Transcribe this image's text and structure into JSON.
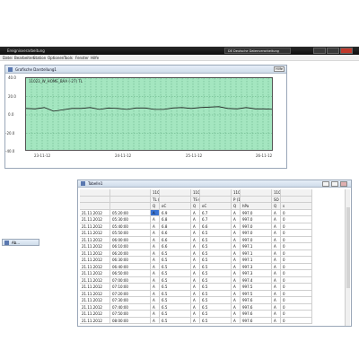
{
  "app": {
    "title": "Ereignisverarbeitung",
    "right_title": "DE Deutsche Datenverarbeitung",
    "menu": [
      "Datei",
      "Bearbeiten",
      "Station",
      "Optionen",
      "Tools",
      "Fenster",
      "Hilfe"
    ]
  },
  "graph_window": {
    "title": "Grafische Darstellung1",
    "tag": "Hilfe",
    "series_label": "11023_W_HOME_BAA (-27) TL"
  },
  "chart_data": {
    "type": "line",
    "title": "",
    "series": [
      {
        "name": "11023_W_HOME_BAA (-27) TL",
        "x": [
          0,
          10,
          20,
          30,
          40,
          50,
          60,
          70,
          80,
          90,
          100,
          110,
          120,
          130,
          140,
          150,
          160,
          170,
          180,
          190,
          200,
          210,
          220,
          230,
          240,
          250,
          260,
          270
        ],
        "values": [
          7,
          6.5,
          8,
          4,
          5.5,
          7,
          7,
          8,
          6,
          7.5,
          7,
          6,
          7.5,
          7.5,
          6,
          6,
          7.5,
          8,
          7,
          8,
          8.5,
          9,
          7,
          6.5,
          8,
          6.5,
          6.5,
          6
        ]
      }
    ],
    "yticks": [
      "40.0",
      "20.0",
      "0.0",
      "-20.0",
      "-40.0"
    ],
    "ylim": [
      -40,
      40
    ],
    "xticks": [
      "23-11-12",
      "24-11-12",
      "25-11-12",
      "26-11-12"
    ],
    "grid": true,
    "background": "#a4e6c0",
    "line_color": "#1a1a1a"
  },
  "minimized": {
    "title": "Ab..."
  },
  "table_window": {
    "title": "Tabelle1",
    "headers": {
      "row1": [
        "",
        "",
        "11023_W_HOME_W",
        "",
        "11023_W_HOME_W",
        "",
        "11023_W_HOME_W",
        "",
        "11023_W_HOME_W",
        ""
      ],
      "row2": [
        "",
        "",
        "TL (27)",
        "",
        "TS (38)",
        "",
        "P (18)",
        "",
        "SO (42)",
        ""
      ],
      "row3": [
        "",
        "",
        "Q",
        "oC",
        "Q",
        "oC",
        "Q",
        "hPa",
        "Q",
        "s"
      ]
    },
    "rows": [
      [
        "21.11.2012",
        "05:20:00",
        "A",
        "6.9",
        "A",
        "6.7",
        "A",
        "997.0",
        "A",
        "0"
      ],
      [
        "21.11.2012",
        "05:30:00",
        "A",
        "6.8",
        "A",
        "6.7",
        "A",
        "997.0",
        "A",
        "0"
      ],
      [
        "21.11.2012",
        "05:40:00",
        "A",
        "6.8",
        "A",
        "6.6",
        "A",
        "997.0",
        "A",
        "0"
      ],
      [
        "21.11.2012",
        "05:50:00",
        "A",
        "6.6",
        "A",
        "6.5",
        "A",
        "997.0",
        "A",
        "0"
      ],
      [
        "21.11.2012",
        "06:00:00",
        "A",
        "6.6",
        "A",
        "6.5",
        "A",
        "997.0",
        "A",
        "0"
      ],
      [
        "21.11.2012",
        "06:10:00",
        "A",
        "6.6",
        "A",
        "6.5",
        "A",
        "997.1",
        "A",
        "0"
      ],
      [
        "21.11.2012",
        "06:20:00",
        "A",
        "6.5",
        "A",
        "6.5",
        "A",
        "997.1",
        "A",
        "0"
      ],
      [
        "21.11.2012",
        "06:30:00",
        "A",
        "6.5",
        "A",
        "6.5",
        "A",
        "997.1",
        "A",
        "0"
      ],
      [
        "21.11.2012",
        "06:40:00",
        "A",
        "6.5",
        "A",
        "6.5",
        "A",
        "997.3",
        "A",
        "0"
      ],
      [
        "21.11.2012",
        "06:50:00",
        "A",
        "6.5",
        "A",
        "6.5",
        "A",
        "997.3",
        "A",
        "0"
      ],
      [
        "21.11.2012",
        "07:00:00",
        "A",
        "6.5",
        "A",
        "6.5",
        "A",
        "997.4",
        "A",
        "0"
      ],
      [
        "21.11.2012",
        "07:10:00",
        "A",
        "6.5",
        "A",
        "6.5",
        "A",
        "997.5",
        "A",
        "0"
      ],
      [
        "21.11.2012",
        "07:20:00",
        "A",
        "6.5",
        "A",
        "6.5",
        "A",
        "997.5",
        "A",
        "0"
      ],
      [
        "21.11.2012",
        "07:30:00",
        "A",
        "6.5",
        "A",
        "6.5",
        "A",
        "997.6",
        "A",
        "0"
      ],
      [
        "21.11.2012",
        "07:40:00",
        "A",
        "6.5",
        "A",
        "6.5",
        "A",
        "997.6",
        "A",
        "0"
      ],
      [
        "21.11.2012",
        "07:50:00",
        "A",
        "6.5",
        "A",
        "6.5",
        "A",
        "997.6",
        "A",
        "0"
      ],
      [
        "21.11.2012",
        "08:00:00",
        "A",
        "6.5",
        "A",
        "6.5",
        "A",
        "997.6",
        "A",
        "0"
      ]
    ]
  }
}
